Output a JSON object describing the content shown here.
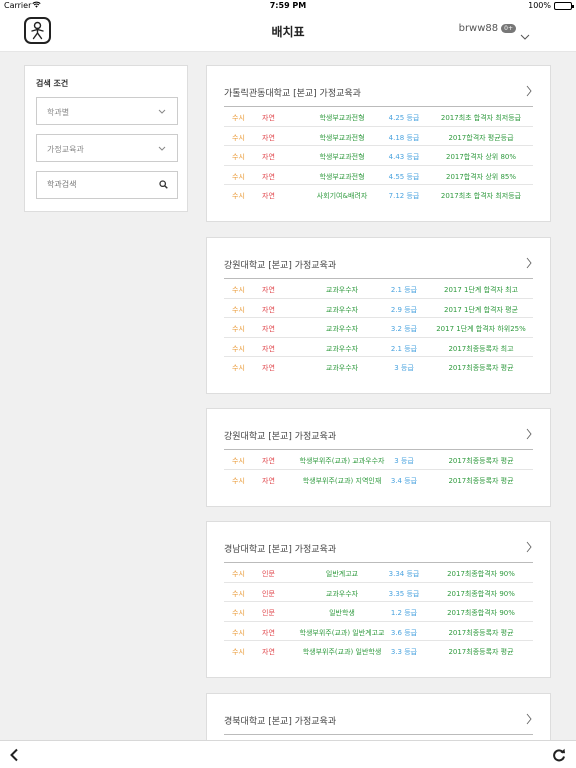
{
  "status_bar": {
    "carrier": "Carrier",
    "time": "7:59 PM",
    "battery": "100%",
    "battery_level": 1.0
  },
  "nav": {
    "title": "배치표",
    "username": "brww88",
    "badge": "0+"
  },
  "filter": {
    "title": "검색 조건",
    "fields": [
      {
        "value": "학과별"
      },
      {
        "value": "가정교육과"
      }
    ],
    "search_placeholder": "학과검색"
  },
  "cards": [
    {
      "title": "가톨릭관동대학교 [본교] 가정교육과",
      "rows": [
        {
          "type": "수시",
          "field": "자연",
          "method": "학생부교과전형",
          "grade": "4.25 등급",
          "note": "2017최초 합격자 최저등급"
        },
        {
          "type": "수시",
          "field": "자연",
          "method": "학생부교과전형",
          "grade": "4.18 등급",
          "note": "2017합격자 평균등급"
        },
        {
          "type": "수시",
          "field": "자연",
          "method": "학생부교과전형",
          "grade": "4.43 등급",
          "note": "2017합격자 상위 80%"
        },
        {
          "type": "수시",
          "field": "자연",
          "method": "학생부교과전형",
          "grade": "4.55 등급",
          "note": "2017합격자 상위 85%"
        },
        {
          "type": "수시",
          "field": "자연",
          "method": "사회기여&배려자",
          "grade": "7.12 등급",
          "note": "2017최초 합격자 최저등급"
        }
      ]
    },
    {
      "title": "강원대학교 [본교] 가정교육과",
      "rows": [
        {
          "type": "수시",
          "field": "자연",
          "method": "교과우수자",
          "grade": "2.1 등급",
          "note": "2017 1단계 합격자 최고"
        },
        {
          "type": "수시",
          "field": "자연",
          "method": "교과우수자",
          "grade": "2.9 등급",
          "note": "2017 1단계 합격자 평균"
        },
        {
          "type": "수시",
          "field": "자연",
          "method": "교과우수자",
          "grade": "3.2 등급",
          "note": "2017 1단계 합격자 하위25%"
        },
        {
          "type": "수시",
          "field": "자연",
          "method": "교과우수자",
          "grade": "2.1 등급",
          "note": "2017최종등록자 최고"
        },
        {
          "type": "수시",
          "field": "자연",
          "method": "교과우수자",
          "grade": "3 등급",
          "note": "2017최종등록자 평균"
        }
      ]
    },
    {
      "title": "강원대학교 [본교] 가정교육과",
      "rows": [
        {
          "type": "수시",
          "field": "자연",
          "method": "학생부위주(교과) 교과우수자",
          "grade": "3 등급",
          "note": "2017최종등록자 평균"
        },
        {
          "type": "수시",
          "field": "자연",
          "method": "학생부위주(교과) 지역인재",
          "grade": "3.4 등급",
          "note": "2017최종등록자 평균"
        }
      ]
    },
    {
      "title": "경남대학교 [본교] 가정교육과",
      "rows": [
        {
          "type": "수시",
          "field": "인문",
          "method": "일반계고교",
          "grade": "3.34 등급",
          "note": "2017최종합격자 90%"
        },
        {
          "type": "수시",
          "field": "인문",
          "method": "교과우수자",
          "grade": "3.35 등급",
          "note": "2017최종합격자 90%"
        },
        {
          "type": "수시",
          "field": "인문",
          "method": "일반학생",
          "grade": "1.2 등급",
          "note": "2017최종합격자 90%"
        },
        {
          "type": "수시",
          "field": "자연",
          "method": "학생부위주(교과) 일반계고교",
          "grade": "3.6 등급",
          "note": "2017최종등록자 평균"
        },
        {
          "type": "수시",
          "field": "자연",
          "method": "학생부위주(교과) 일반학생",
          "grade": "3.3 등급",
          "note": "2017최종등록자 평균"
        }
      ]
    },
    {
      "title": "경북대학교 [본교] 가정교육과",
      "rows": []
    }
  ],
  "colors": {
    "type": "#e8952e",
    "field": "#e0474c",
    "method": "#2f9a3e",
    "grade": "#4aa3df",
    "note": "#2f9a3e"
  },
  "icons": {
    "logo": "person-logo-icon",
    "user_menu": "chevron-down-icon",
    "select": "chevron-down-icon",
    "search": "search-icon",
    "card_open": "chevron-right-icon",
    "back": "chevron-left-icon",
    "refresh": "refresh-icon"
  }
}
